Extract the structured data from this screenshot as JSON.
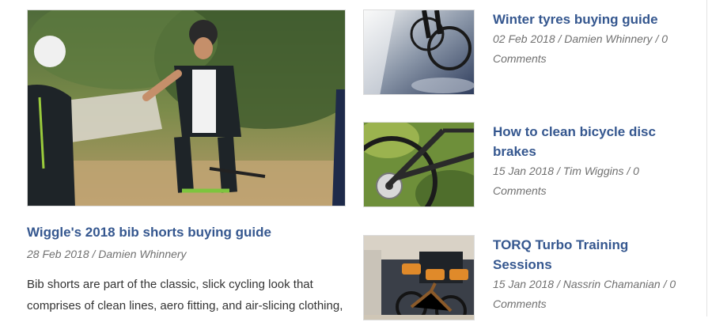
{
  "featured": {
    "title": "Wiggle's 2018 bib shorts buying guide",
    "meta": "28 Feb 2018 / Damien Whinnery",
    "excerpt": "Bib shorts are part of the classic, slick cycling look that comprises of clean lines, aero fitting, and air-slicing clothing,"
  },
  "side_posts": [
    {
      "title": "Winter tyres buying guide",
      "meta": "02 Feb 2018 / Damien Whinnery / 0 Comments"
    },
    {
      "title": "How to clean bicycle disc brakes",
      "meta": "15 Jan 2018 / Tim Wiggins / 0 Comments"
    },
    {
      "title": "TORQ Turbo Training Sessions",
      "meta": "15 Jan 2018 / Nassrin Chamanian / 0 Comments"
    }
  ],
  "colors": {
    "link": "#35578f",
    "meta": "#707070",
    "body_text": "#333333"
  }
}
